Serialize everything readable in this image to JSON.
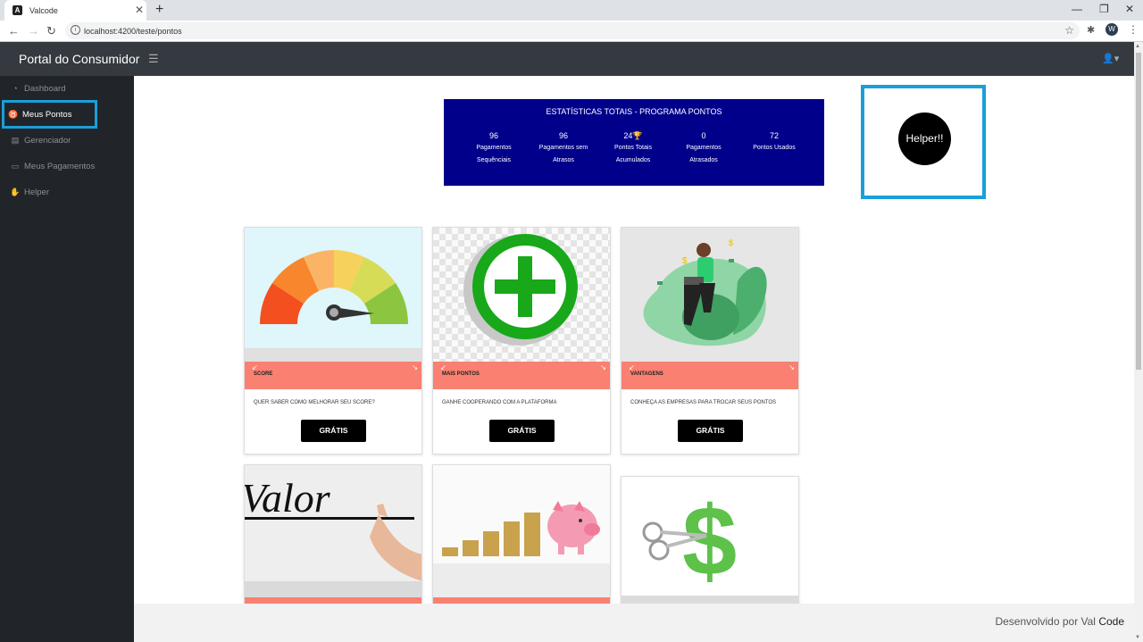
{
  "browser": {
    "tab_title": "Valcode",
    "url": "localhost:4200/teste/pontos",
    "profile_initial": "W"
  },
  "app": {
    "brand": "Portal do Consumidor",
    "footer_prefix": "Desenvolvido por Val ",
    "footer_emphasis": "Code"
  },
  "sidebar": {
    "items": [
      {
        "label": "Dashboard",
        "icon": "tachometer-icon"
      },
      {
        "label": "Meus Pontos",
        "icon": "medal-icon",
        "active": true
      },
      {
        "label": "Gerenciador",
        "icon": "money-bill-icon"
      },
      {
        "label": "Meus Pagamentos",
        "icon": "credit-card-icon"
      },
      {
        "label": "Helper",
        "icon": "handshake-icon"
      }
    ]
  },
  "stats": {
    "title": "ESTATÍSTICAS TOTAIS - PROGRAMA PONTOS",
    "items": [
      {
        "value": "96",
        "label1": "Pagamentos",
        "label2": "Sequênciais"
      },
      {
        "value": "96",
        "label1": "Pagamentos sem",
        "label2": "Atrasos"
      },
      {
        "value": "24🏆",
        "label1": "Pontos Totais",
        "label2": "Acumulados"
      },
      {
        "value": "0",
        "label1": "Pagamentos",
        "label2": "Atrasados"
      },
      {
        "value": "72",
        "label1": "Pontos Usados",
        "label2": ""
      }
    ]
  },
  "helper_button": "Helper!!",
  "cards": [
    {
      "title": "SCORE",
      "description": "QUER SABER COMO MELHORAR SEU SCORE?",
      "button": "GRÁTIS"
    },
    {
      "title": "MAIS PONTOS",
      "description": "GANHE COOPERANDO COM A PLATAFORMA",
      "button": "GRÁTIS"
    },
    {
      "title": "VANTAGENS",
      "description": "CONHEÇA AS EMPRESAS PARA TROCAR SEUS PONTOS",
      "button": "GRÁTIS"
    }
  ],
  "image_text": {
    "valor": "Valor"
  },
  "colors": {
    "stats_bg": "#00008b",
    "card_band": "#fa8072",
    "highlight": "#1a9fd9",
    "sidebar_bg": "#212529",
    "topnav_bg": "#343a40"
  }
}
